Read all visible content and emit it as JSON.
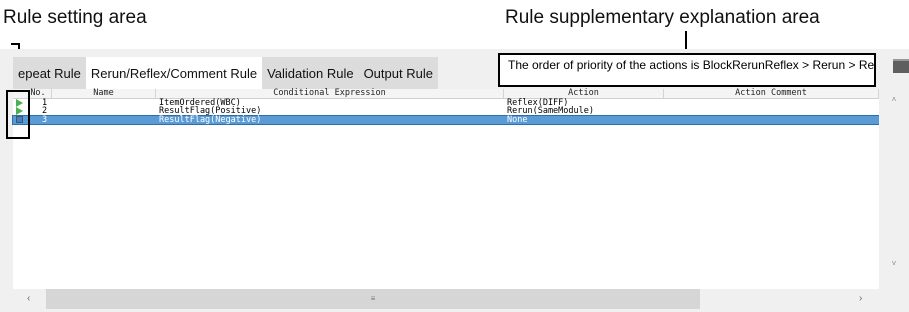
{
  "callouts": {
    "rule_setting_area": "Rule setting area",
    "supplementary_area": "Rule supplementary explanation area"
  },
  "tabs": [
    {
      "label": "epeat Rule",
      "active": false
    },
    {
      "label": "Rerun/Reflex/Comment Rule",
      "active": true
    },
    {
      "label": "Validation Rule",
      "active": false
    },
    {
      "label": "Output Rule",
      "active": false
    }
  ],
  "explanation_text": "The order of priority of the actions is BlockRerunReflex > Rerun > Reflex",
  "grid": {
    "headers": {
      "no": "No.",
      "name": "Name",
      "condition": "Conditional Expression",
      "action": "Action",
      "comment": "Action Comment"
    },
    "rows": [
      {
        "no": "1",
        "name": "",
        "condition": "ItemOrdered(WBC)",
        "action": "Reflex(DIFF)",
        "comment": "",
        "marker": "play-icon"
      },
      {
        "no": "2",
        "name": "",
        "condition": "ResultFlag(Positive)",
        "action": "Rerun(SameModule)",
        "comment": "",
        "marker": "play-icon"
      },
      {
        "no": "3",
        "name": "",
        "condition": "ResultFlag(Negative)",
        "action": "None",
        "comment": "",
        "marker": "edit-icon",
        "selected": true
      }
    ]
  },
  "scroll": {
    "up": "˄",
    "down": "˅",
    "left": "‹",
    "right": "›",
    "thumb_grip": "≡"
  },
  "colors": {
    "selected_row": "#5b9bd5",
    "play_marker": "#4caf50",
    "edit_marker": "#4a7fb5"
  }
}
